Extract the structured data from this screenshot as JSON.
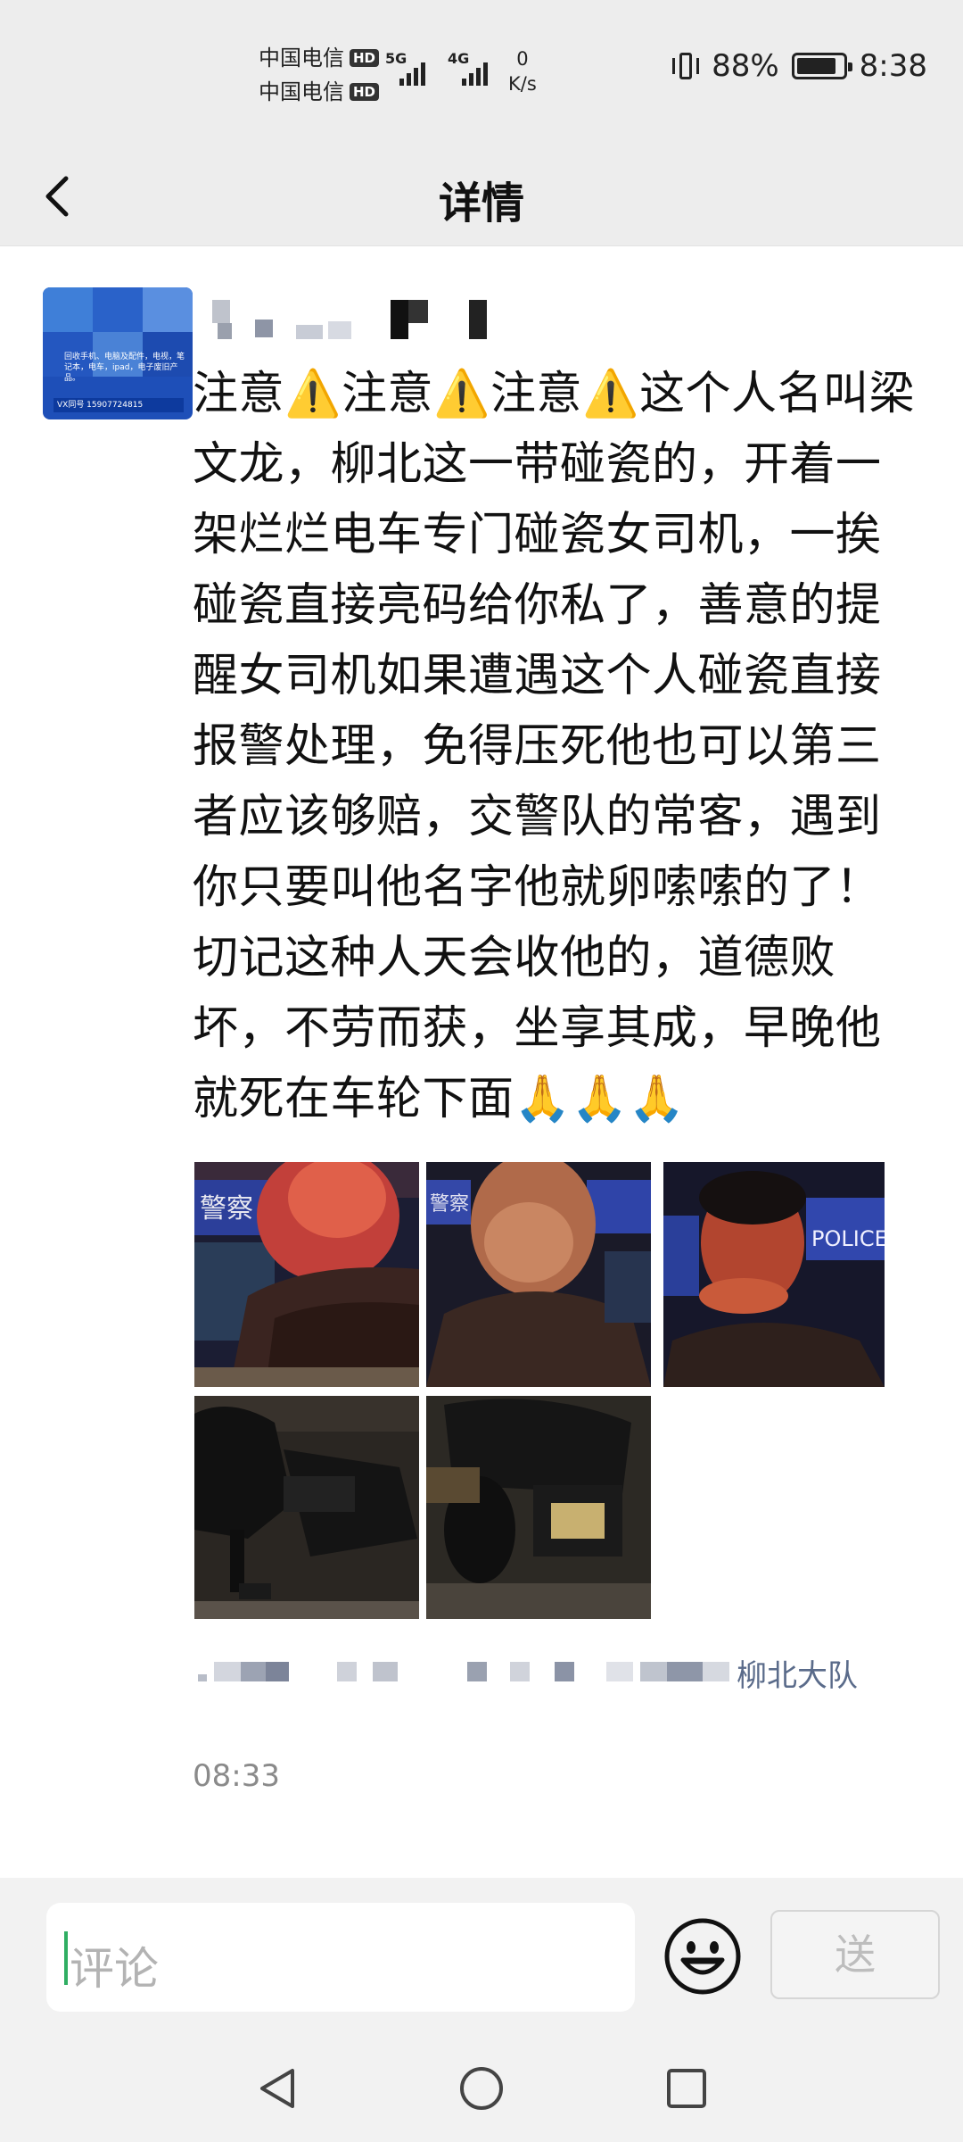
{
  "status_bar": {
    "carrier1": "中国电信",
    "carrier2": "中国电信",
    "hd": "HD",
    "net1": "5G",
    "net2": "4G",
    "speed_value": "0",
    "speed_unit": "K/s",
    "battery": "88%",
    "time": "8:38"
  },
  "header": {
    "title": "详情"
  },
  "post": {
    "avatar_text": "回收手机、电脑及配件，电视，笔记本，电车，ipad，电子废旧产品。",
    "avatar_vx": "VX同号 15907724815",
    "content": "注意⚠️注意⚠️注意⚠️这个人名叫梁文龙，柳北这一带碰瓷的，开着一架烂烂电车专门碰瓷女司机，一挨碰瓷直接亮码给你私了，善意的提醒女司机如果遭遇这个人碰瓷直接报警处理，免得压死他也可以第三者应该够赔，交警队的常客，遇到你只要叫他名字他就卵嗦嗦的了！ 切记这种人天会收他的，道德败坏，不劳而获，坐享其成，早晚他就死在车轮下面🙏🙏🙏",
    "location": "柳北大队",
    "time": "08:33",
    "photos": [
      {
        "sign": "警察"
      },
      {
        "sign": "警察 POLICE"
      },
      {
        "sign": "POLICE"
      },
      {
        "sign": ""
      },
      {
        "sign": ""
      }
    ]
  },
  "comment": {
    "placeholder": "评论",
    "send_label": "送"
  },
  "icons": {
    "back": "chevron-left-icon",
    "emoji": "smiley-icon",
    "nav_back": "triangle-back-icon",
    "nav_home": "circle-home-icon",
    "nav_recent": "square-recent-icon"
  }
}
